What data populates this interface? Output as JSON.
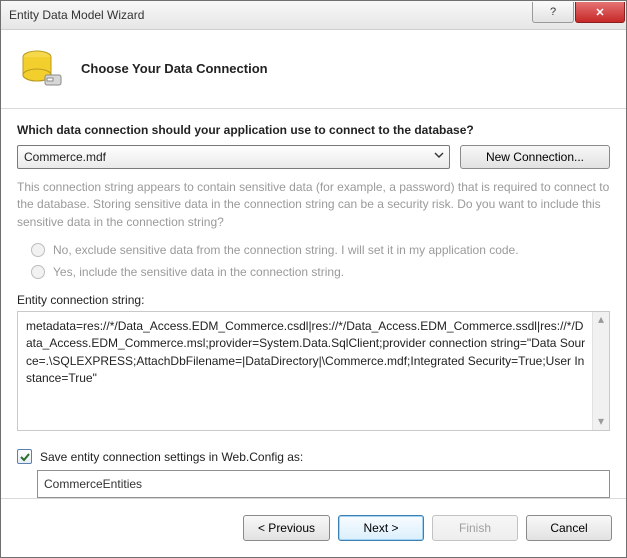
{
  "window_title": "Entity Data Model Wizard",
  "header_title": "Choose Your Data Connection",
  "question": "Which data connection should your application use to connect to the database?",
  "selected_connection": "Commerce.mdf",
  "new_connection_label": "New Connection...",
  "sensitive_note": "This connection string appears to contain sensitive data (for example, a password) that is required to connect to the database. Storing sensitive data in the connection string can be a security risk. Do you want to include this sensitive data in the connection string?",
  "radio_exclude": "No, exclude sensitive data from the connection string. I will set it in my application code.",
  "radio_include": "Yes, include the sensitive data in the connection string.",
  "conn_label": "Entity connection string:",
  "conn_string": "metadata=res://*/Data_Access.EDM_Commerce.csdl|res://*/Data_Access.EDM_Commerce.ssdl|res://*/Data_Access.EDM_Commerce.msl;provider=System.Data.SqlClient;provider connection string=\"Data Source=.\\SQLEXPRESS;AttachDbFilename=|DataDirectory|\\Commerce.mdf;Integrated Security=True;User Instance=True\"",
  "save_checkbox_label": "Save entity connection settings in Web.Config as:",
  "save_checkbox_checked": true,
  "config_name": "CommerceEntities",
  "buttons": {
    "previous": "< Previous",
    "next": "Next >",
    "finish": "Finish",
    "cancel": "Cancel"
  }
}
